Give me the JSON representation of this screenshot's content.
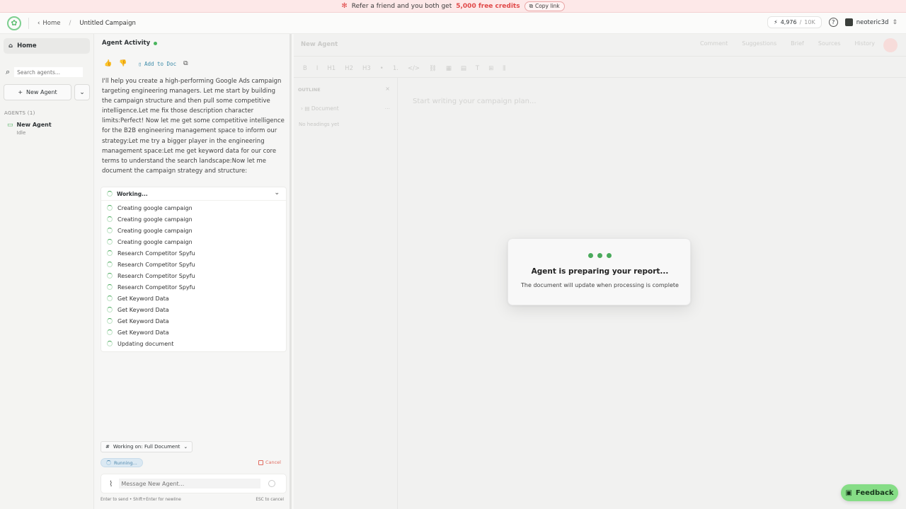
{
  "banner": {
    "text_before": "Refer a friend and you both get",
    "highlight": "5,000 free credits",
    "copy_label": "Copy link"
  },
  "topbar": {
    "breadcrumb_home": "Home",
    "breadcrumb_current": "Untitled Campaign",
    "credits_used": "4,976",
    "credits_sep": "/",
    "credits_total": "10K",
    "help_glyph": "?",
    "username": "neoteric3d"
  },
  "sidebar": {
    "home_label": "Home",
    "search_placeholder": "Search agents...",
    "new_agent_label": "New Agent",
    "section_label": "AGENTS (1)",
    "agents": [
      {
        "name": "New Agent",
        "status": "Idle"
      }
    ]
  },
  "chat": {
    "title": "Agent Activity",
    "add_to_doc": "Add to Doc",
    "message": "I'll help you create a high-performing Google Ads campaign targeting engineering managers. Let me start by building the campaign structure and then pull some competitive intelligence.Let me fix those description character limits:Perfect! Now let me get some competitive intelligence for the B2B engineering management space to inform our strategy:Let me try a bigger player in the engineering management space:Let me get keyword data for our core terms to understand the search landscape:Now let me document the campaign strategy and structure:",
    "working_label": "Working...",
    "tasks": [
      "Creating google campaign",
      "Creating google campaign",
      "Creating google campaign",
      "Creating google campaign",
      "Research Competitor Spyfu",
      "Research Competitor Spyfu",
      "Research Competitor Spyfu",
      "Research Competitor Spyfu",
      "Get Keyword Data",
      "Get Keyword Data",
      "Get Keyword Data",
      "Get Keyword Data",
      "Updating document"
    ],
    "context_label": "Working on: Full Document",
    "running_label": "Running...",
    "cancel_label": "Cancel",
    "input_placeholder": "Message New Agent...",
    "hint_left": "Enter to send • Shift+Enter for newline",
    "hint_right": "ESC to cancel"
  },
  "editor": {
    "title": "New Agent",
    "tabs": [
      "Comment",
      "Suggestions",
      "Brief",
      "Sources",
      "History"
    ],
    "toolbar_glyphs": [
      "B",
      "I",
      "H1",
      "H2",
      "H3",
      "•",
      "1.",
      "</>",
      "⛓",
      "▦",
      "▤",
      "T",
      "⊞",
      "⫼"
    ],
    "outline_label": "OUTLINE",
    "outline_doc": "Document",
    "no_headings": "No headings yet",
    "placeholder": "Start writing your campaign plan..."
  },
  "report": {
    "title": "Agent is preparing your report...",
    "subtitle": "The document will update when processing is complete"
  },
  "feedback_label": "Feedback",
  "colors": {
    "accent_green": "#4aaa5c",
    "banner_red": "#e04848",
    "running_blue": "#4d86ab",
    "cancel_red": "#e06b5f",
    "feedback_bg": "#86dd86"
  }
}
